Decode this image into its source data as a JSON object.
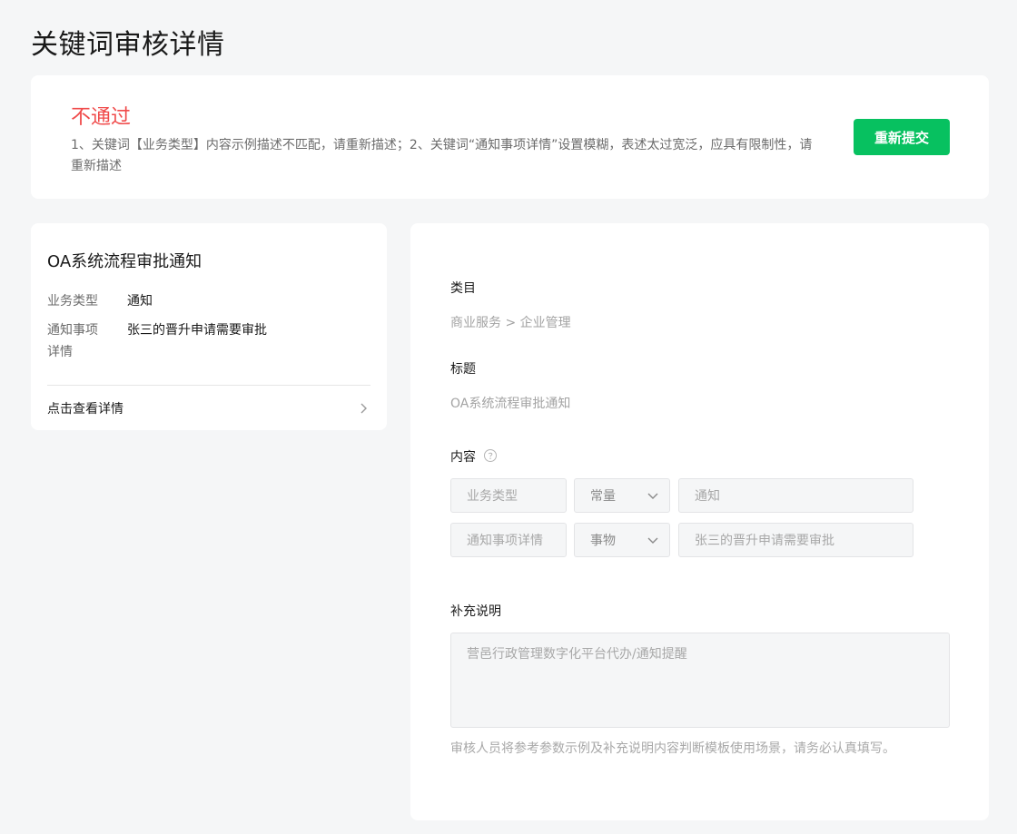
{
  "page": {
    "title": "关键词审核详情"
  },
  "status": {
    "title": "不通过",
    "description": "1、关键词【业务类型】内容示例描述不匹配，请重新描述；2、关键词“通知事项详情”设置模糊，表述太过宽泛，应具有限制性，请重新描述",
    "resubmit_label": "重新提交",
    "title_color": "#f04b4b",
    "button_color": "#07c160"
  },
  "preview": {
    "title": "OA系统流程审批通知",
    "rows": [
      {
        "key": "业务类型",
        "value": "通知"
      },
      {
        "key": "通知事项详情",
        "value": "张三的晋升申请需要审批"
      }
    ],
    "link_label": "点击查看详情",
    "link_icon": "chevron-right-icon"
  },
  "form": {
    "category": {
      "label": "类目",
      "value": "商业服务 > 企业管理"
    },
    "title": {
      "label": "标题",
      "value": "OA系统流程审批通知"
    },
    "content": {
      "label": "内容",
      "help_icon": "question-circle-icon",
      "rows": [
        {
          "name": "业务类型",
          "type": "常量",
          "example": "通知"
        },
        {
          "name": "通知事项详情",
          "type": "事物",
          "example": "张三的晋升申请需要审批"
        }
      ]
    },
    "note": {
      "label": "补充说明",
      "placeholder": "营邑行政管理数字化平台代办/通知提醒"
    },
    "hint": "审核人员将参考参数示例及补充说明内容判断模板使用场景，请务必认真填写。"
  }
}
